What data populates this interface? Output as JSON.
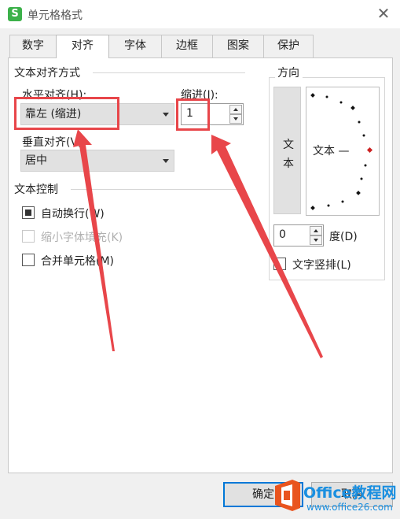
{
  "window": {
    "title": "单元格格式",
    "app_icon_letter": "S",
    "close_glyph": "✕"
  },
  "tabs": [
    {
      "label": "数字",
      "active": false
    },
    {
      "label": "对齐",
      "active": true
    },
    {
      "label": "字体",
      "active": false
    },
    {
      "label": "边框",
      "active": false
    },
    {
      "label": "图案",
      "active": false
    },
    {
      "label": "保护",
      "active": false
    }
  ],
  "alignment": {
    "group_label": "文本对齐方式",
    "horizontal_label": "水平对齐(H):",
    "horizontal_value": "靠左 (缩进)",
    "indent_label": "缩进(I):",
    "indent_value": "1",
    "vertical_label": "垂直对齐(V):",
    "vertical_value": "居中"
  },
  "text_control": {
    "group_label": "文本控制",
    "wrap_text": {
      "label": "自动换行(W)",
      "checked": true,
      "enabled": true
    },
    "shrink_to_fit": {
      "label": "缩小字体填充(K)",
      "checked": false,
      "enabled": false
    },
    "merge_cells": {
      "label": "合并单元格(M)",
      "checked": false,
      "enabled": true
    }
  },
  "orientation": {
    "group_label": "方向",
    "vertical_text_chars": [
      "文",
      "本"
    ],
    "dial_text": "文本 —",
    "degree_value": "0",
    "degree_label": "度(D)",
    "vertical_layout_label": "文字竖排(L)",
    "vertical_layout_checked": false
  },
  "buttons": {
    "ok": "确定",
    "cancel": "取消"
  },
  "watermark": {
    "line1": "Office教程网",
    "line2": "www.office26.com"
  },
  "colors": {
    "highlight": "#e8464a",
    "accent": "#0078d7",
    "watermark": "#1a8fe0",
    "dial_indicator": "#cc2222"
  }
}
